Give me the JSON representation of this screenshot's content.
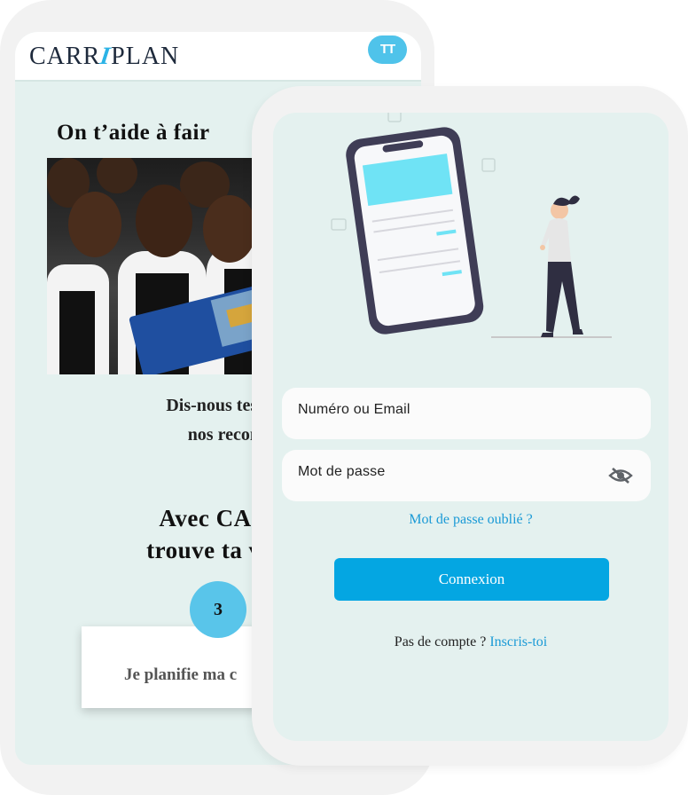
{
  "back_screen": {
    "logo": {
      "left": "CARR",
      "mark": "I",
      "right": "PLAN"
    },
    "avatar_initials": "TT",
    "hero_title": "On t’aide à fair",
    "intro_line1": "Dis-nous tes notes, p",
    "intro_line2": "nos recomman",
    "tagline_line1": "Avec CARRI",
    "tagline_line2": "trouve ta voie e",
    "step_number": "3",
    "plan_card_text": "Je planifie ma c"
  },
  "login": {
    "identifier_placeholder": "Numéro ou Email",
    "password_placeholder": "Mot de passe",
    "forgot_password": "Mot de passe oublié ?",
    "submit_label": "Connexion",
    "no_account": "Pas de compte ?",
    "signup_link": "Inscris-toi"
  },
  "colors": {
    "accent": "#04a6e2",
    "link": "#1a9ad6",
    "screen_bg": "#e4f1ef",
    "phone_frame": "#f2f2f2",
    "illustration_cyan": "#6fe3f5"
  },
  "icons": {
    "password_visibility": "eye-slash-icon"
  }
}
